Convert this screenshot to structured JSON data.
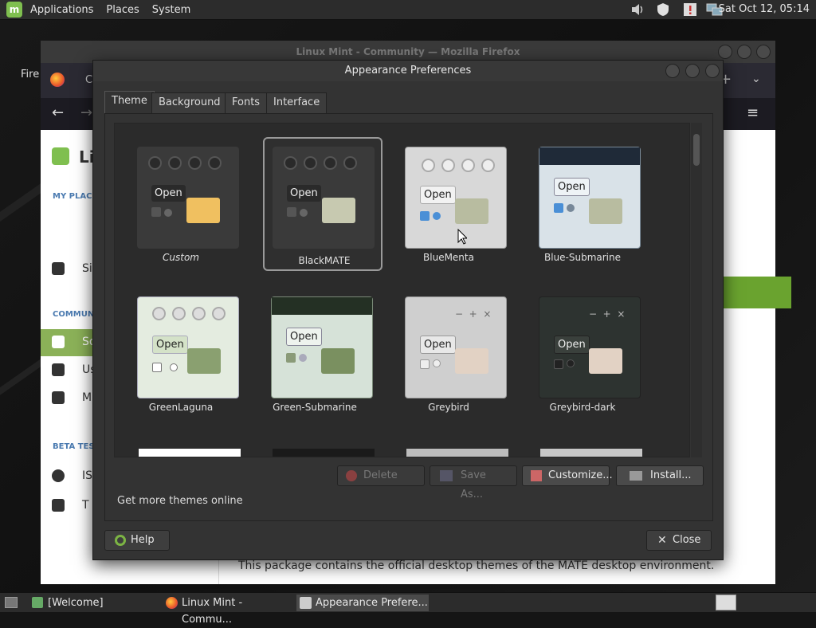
{
  "top_panel": {
    "menus": [
      "Applications",
      "Places",
      "System"
    ],
    "clock": "Sat Oct 12, 05:14"
  },
  "firefox": {
    "title": "Linux Mint - Community — Mozilla Firefox",
    "sidebar": {
      "section1": "MY PLACE",
      "section2": "COMMUN",
      "section3": "BETA TES",
      "items": [
        "Si",
        "So",
        "Us",
        "M",
        "IS",
        "T"
      ]
    },
    "package_text": "This package contains the official desktop themes of the MATE desktop environment."
  },
  "dialog": {
    "title": "Appearance Preferences",
    "tabs": [
      "Theme",
      "Background",
      "Fonts",
      "Interface"
    ],
    "themes": [
      {
        "name": "Custom",
        "italic": true
      },
      {
        "name": "BlackMATE",
        "selected": true
      },
      {
        "name": "BlueMenta"
      },
      {
        "name": "Blue-Submarine"
      },
      {
        "name": "GreenLaguna"
      },
      {
        "name": "Green-Submarine"
      },
      {
        "name": "Greybird"
      },
      {
        "name": "Greybird-dark"
      }
    ],
    "open_label": "Open",
    "buttons": {
      "delete": "Delete",
      "save_as": "Save As...",
      "customize": "Customize...",
      "install": "Install..."
    },
    "more_online": "Get more themes online",
    "help": "Help",
    "close": "Close"
  },
  "taskbar": {
    "items": [
      "[Welcome]",
      "Linux Mint - Commu...",
      "Appearance Prefere..."
    ]
  }
}
